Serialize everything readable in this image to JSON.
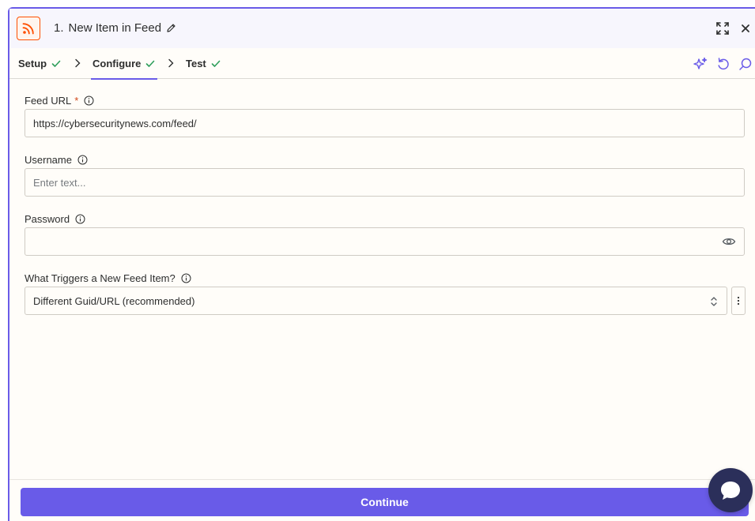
{
  "header": {
    "step_number": "1.",
    "step_title": "New Item in Feed"
  },
  "tabs": [
    {
      "label": "Setup",
      "complete": true
    },
    {
      "label": "Configure",
      "complete": true,
      "active": true
    },
    {
      "label": "Test",
      "complete": true
    }
  ],
  "fields": {
    "feed_url": {
      "label": "Feed URL",
      "required_mark": "*",
      "value": "https://cybersecuritynews.com/feed/"
    },
    "username": {
      "label": "Username",
      "placeholder": "Enter text..."
    },
    "password": {
      "label": "Password",
      "value": ""
    },
    "trigger": {
      "label": "What Triggers a New Feed Item?",
      "value": "Different Guid/URL (recommended)"
    }
  },
  "footer": {
    "continue_label": "Continue"
  },
  "colors": {
    "accent": "#695be8",
    "brand_orange": "#ff4f00",
    "success": "#2e9e5b",
    "chat": "#2b2f5a"
  },
  "icons": [
    "rss-icon",
    "pencil-icon",
    "expand-icon",
    "close-icon",
    "check-icon",
    "chevron-right-icon",
    "sparkle-icon",
    "undo-icon",
    "search-icon",
    "info-icon",
    "eye-icon",
    "updown-icon",
    "kebab-icon",
    "chat-icon"
  ]
}
